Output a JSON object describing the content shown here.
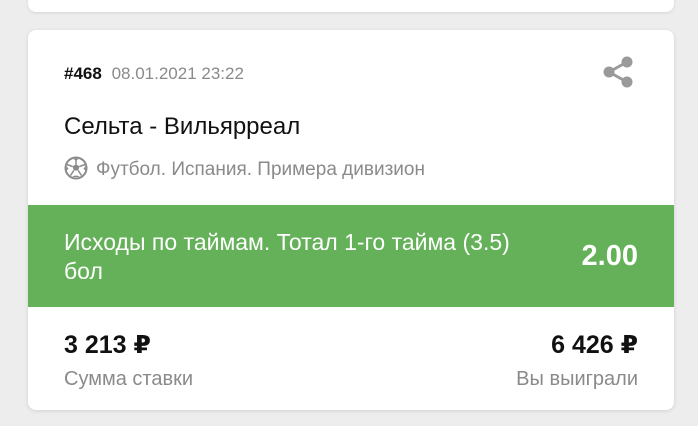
{
  "bet": {
    "id": "#468",
    "datetime": "08.01.2021 23:22",
    "match": "Сельта - Вильярреал",
    "league": "Футбол. Испания. Примера дивизион",
    "outcome": "Исходы по таймам. Тотал 1-го тайма (3.5) бол",
    "odds": "2.00",
    "stake": "3 213 ₽",
    "stake_label": "Сумма ставки",
    "winnings": "6 426 ₽",
    "winnings_label": "Вы выиграли"
  },
  "icons": {
    "share": "share-icon",
    "sport": "soccer-ball-icon"
  },
  "colors": {
    "outcome_bg": "#65b15a",
    "muted_text": "#8a8a8a",
    "page_bg": "#ededed"
  }
}
